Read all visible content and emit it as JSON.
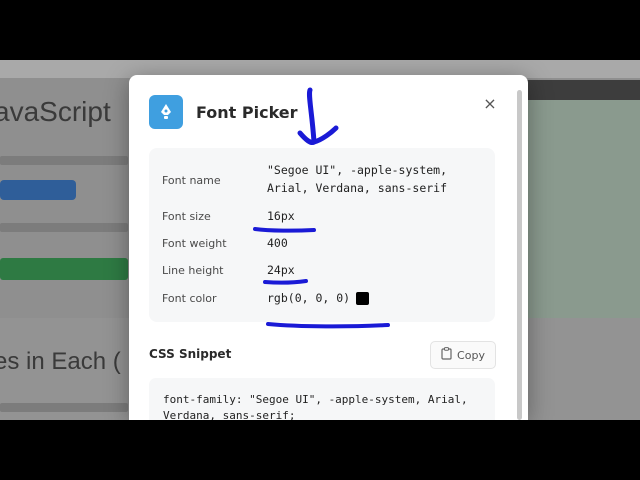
{
  "background": {
    "title": "avaScript",
    "heading": "es in Each ("
  },
  "modal": {
    "title": "Font Picker",
    "close_label": "×",
    "properties": [
      {
        "label": "Font name",
        "value_line1": "\"Segoe UI\", -apple-system,",
        "value_line2": "Arial, Verdana, sans-serif"
      },
      {
        "label": "Font size",
        "value": "16px"
      },
      {
        "label": "Font weight",
        "value": "400"
      },
      {
        "label": "Line height",
        "value": "24px"
      },
      {
        "label": "Font color",
        "value": "rgb(0, 0, 0)",
        "swatch_color": "#000000"
      }
    ],
    "snippet": {
      "title": "CSS Snippet",
      "copy_label": "Copy",
      "code": "font-family: \"Segoe UI\", -apple-system, Arial, Verdana, sans-serif;"
    }
  },
  "colors": {
    "accent": "#3f9fe0",
    "annotation_ink": "#1a1ad6"
  },
  "icons": {
    "app": "pen-nib-icon",
    "close": "close-icon",
    "copy": "clipboard-icon"
  }
}
